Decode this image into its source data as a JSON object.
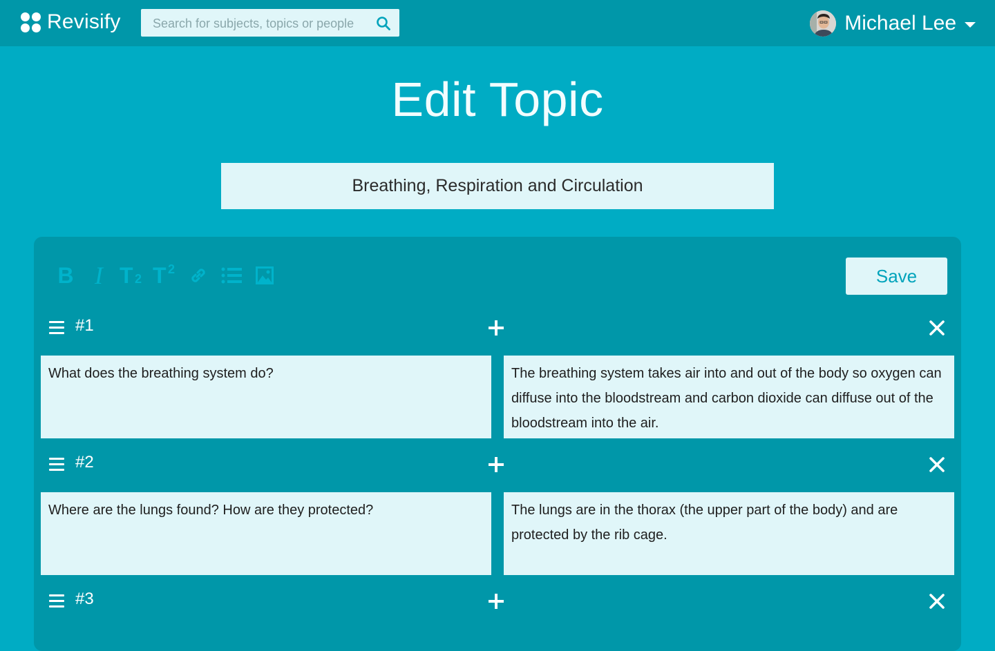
{
  "app": {
    "name": "Revisify"
  },
  "search": {
    "placeholder": "Search for subjects, topics or people"
  },
  "user": {
    "name": "Michael Lee"
  },
  "page": {
    "title": "Edit Topic"
  },
  "topic": {
    "name": "Breathing, Respiration and Circulation"
  },
  "toolbar": {
    "tools": [
      "bold-icon",
      "italic-icon",
      "subscript-icon",
      "superscript-icon",
      "link-icon",
      "list-icon",
      "image-icon"
    ],
    "save_label": "Save"
  },
  "cards": [
    {
      "number": "#1",
      "question": "What does the breathing system do?",
      "answer": "The breathing system takes air into and out of the body so oxygen can diffuse into the bloodstream and carbon dioxide can diffuse out of the bloodstream into the air."
    },
    {
      "number": "#2",
      "question": "Where are the lungs found? How are they protected?",
      "answer": "The lungs are in the thorax (the upper part of the body) and are protected by the rib cage."
    },
    {
      "number": "#3",
      "question": "",
      "answer": ""
    }
  ],
  "colors": {
    "background": "#00acc4",
    "topbar": "#0097a9",
    "panel": "#0097a9",
    "field": "#e0f6f9",
    "toolbar_icons": "#00b3cb",
    "save_text": "#00a3bb"
  }
}
